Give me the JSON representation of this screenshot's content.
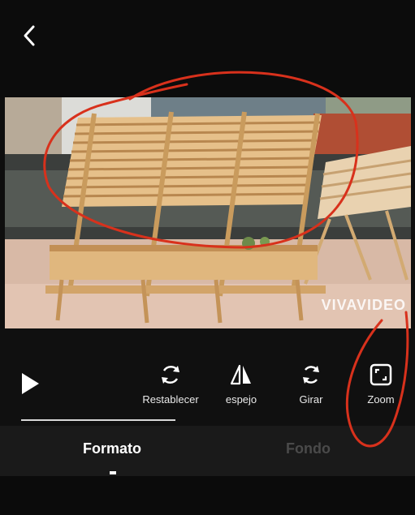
{
  "header": {
    "back_icon": "chevron-left-icon"
  },
  "preview": {
    "watermark": "VIVAVIDEO"
  },
  "toolbar": {
    "play_icon": "play-icon",
    "tools": [
      {
        "id": "reset",
        "label": "Restablecer",
        "icon": "reset-icon"
      },
      {
        "id": "mirror",
        "label": "espejo",
        "icon": "mirror-icon"
      },
      {
        "id": "rotate",
        "label": "Girar",
        "icon": "rotate-icon"
      },
      {
        "id": "zoom",
        "label": "Zoom",
        "icon": "zoom-icon"
      }
    ]
  },
  "tabs": {
    "active": "Formato",
    "inactive": "Fondo"
  },
  "colors": {
    "background": "#0e0e0e",
    "annotation": "#d8311c",
    "tab_inactive": "#4a4a4a"
  }
}
